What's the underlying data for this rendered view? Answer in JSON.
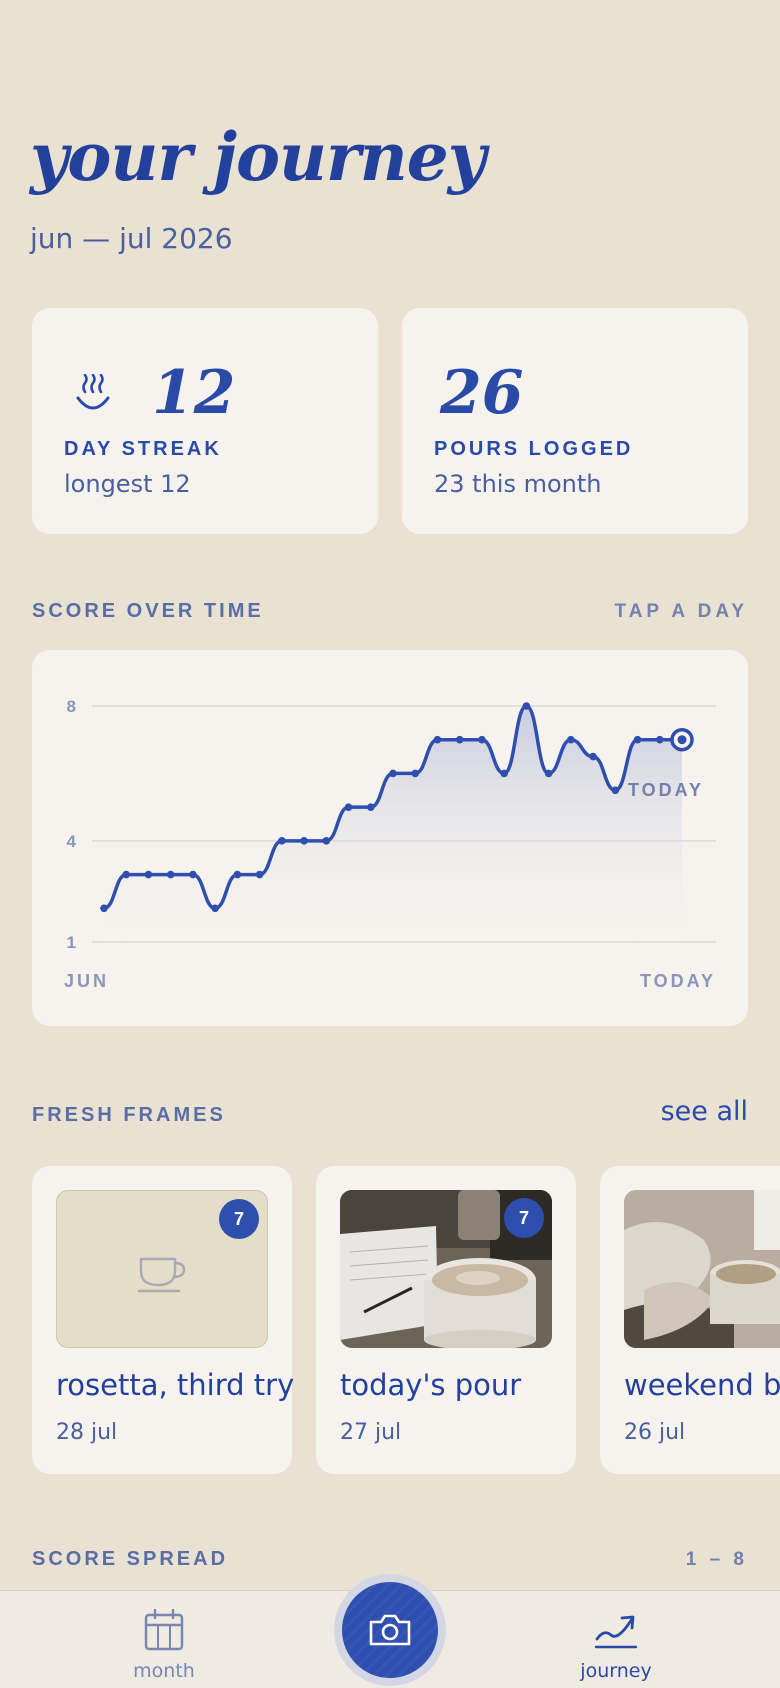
{
  "header": {
    "title": "your journey",
    "subtitle": "jun — jul 2026"
  },
  "stats": [
    {
      "icon": "steaming-cup-icon",
      "value": "12",
      "label": "DAY STREAK",
      "sub": "longest 12"
    },
    {
      "value": "26",
      "label": "POURS LOGGED",
      "sub": "23 this month"
    }
  ],
  "score_section": {
    "label": "SCORE OVER TIME",
    "action": "TAP A DAY",
    "today_marker": "TODAY"
  },
  "chart_data": {
    "type": "line",
    "y_ticks": [
      "8",
      "4",
      "1"
    ],
    "ylim": [
      1,
      8
    ],
    "x_labels": [
      "JUN",
      "TODAY"
    ],
    "values": [
      2,
      3,
      3,
      3,
      3,
      2,
      3,
      3,
      4,
      4,
      4,
      5,
      5,
      6,
      6,
      7,
      7,
      7,
      6,
      8,
      6,
      7,
      6.5,
      5.5,
      7,
      7,
      7
    ],
    "area_fill": true,
    "color": "#2f4fae"
  },
  "frames_section": {
    "label": "FRESH FRAMES",
    "see_all": "see all"
  },
  "frames": [
    {
      "title": "rosetta, third try",
      "date": "28 jul",
      "badge": "7",
      "image": "placeholder-cup-icon"
    },
    {
      "title": "today's pour",
      "date": "27 jul",
      "badge": "7",
      "image": "latte-notebook-photo"
    },
    {
      "title": "weekend brew",
      "date": "26 jul",
      "image": "cozy-coffee-photo"
    }
  ],
  "spread_section": {
    "label": "SCORE SPREAD",
    "range": "1 – 8"
  },
  "nav": {
    "month": "month",
    "journey": "journey",
    "camera": "camera-icon"
  },
  "colors": {
    "background": "#e9e1d2",
    "card": "#f6f3ee",
    "accent": "#2a4aa8"
  }
}
